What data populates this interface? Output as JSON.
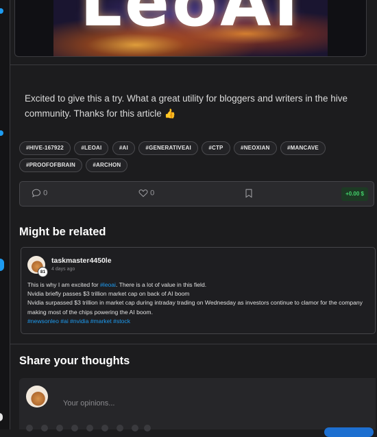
{
  "hero": {
    "logo_text": "LeoAI"
  },
  "comment": {
    "text": "Excited to give this a try. What a great utility for bloggers and writers in the hive community. Thanks for this article 👍"
  },
  "tags": [
    "#HIVE-167922",
    "#LEOAI",
    "#AI",
    "#GENERATIVEAI",
    "#CTP",
    "#NEOXIAN",
    "#MANCAVE",
    "#PROOFOFBRAIN",
    "#ARCHON"
  ],
  "actions": {
    "comments_count": "0",
    "likes_count": "0",
    "payout": "+0.00 $"
  },
  "related": {
    "title": "Might be related",
    "author": "taskmaster4450le",
    "reputation": "81",
    "time": "4 days ago",
    "line1_pre": "This is why I am excited for ",
    "line1_tag": "#leoai",
    "line1_post": ". There is a lot of value in this field.",
    "line2": "Nvidia briefly passes $3 trillion market cap on back of AI boom",
    "line3": "Nvidia surpassed $3 trillion in market cap during intraday trading on Wednesday as investors continue to clamor for the company making most of the chips powering the AI boom.",
    "line4": "#newsonleo #ai #nvidia #market #stock"
  },
  "share": {
    "title": "Share your thoughts",
    "placeholder": "Your opinions..."
  },
  "colors": {
    "accent": "#1d9bf0",
    "payout": "#43d36b",
    "background": "#1c1c1e"
  }
}
